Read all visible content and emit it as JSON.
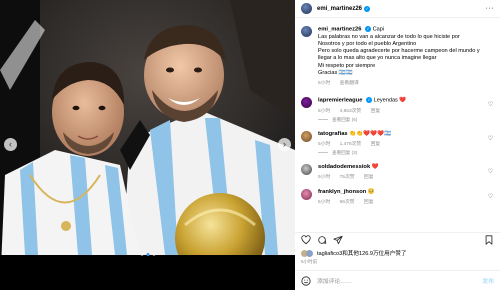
{
  "post": {
    "username": "emi_martinez26",
    "more_label": "···"
  },
  "caption": {
    "username": "emi_martinez26",
    "lines": [
      "Capi",
      "Las palabras no van a alcanzar de todo lo que hiciste por",
      "Nosotros y por todo el pueblo Argentino",
      "Pero solo queda agradecerte por hacerme campeon del mundo y",
      "llegar a lo mas alto que yo nunca imagine llegar",
      "Mi respeto por siempre",
      "Gracias 🇦🇷🇦🇷"
    ],
    "time": "5小时",
    "translate": "查看翻译"
  },
  "comments": [
    {
      "username": "lapremierleague",
      "text": "Leyendas ❤️",
      "time": "5小时",
      "likes": "4,653次赞",
      "reply": "回复",
      "view_replies": "查看回复 (6)"
    },
    {
      "username": "tatografias",
      "text": "👏👏❤️❤️❤️🇦🇷",
      "time": "5小时",
      "likes": "1,476次赞",
      "reply": "回复",
      "view_replies": "查看回复 (3)"
    },
    {
      "username": "soldadodemessiok",
      "text": "❤️",
      "time": "5小时",
      "likes": "75次赞",
      "reply": "回复",
      "view_replies": ""
    },
    {
      "username": "franklyn_jhonson",
      "text": "🥺",
      "time": "5小时",
      "likes": "66次赞",
      "reply": "回复",
      "view_replies": ""
    }
  ],
  "likes_text": "tagliafico3和其他126.9万位用户赞了",
  "post_time": "5小时前",
  "comment_box": {
    "placeholder": "添加评论……",
    "post_label": "发布"
  },
  "colors": {
    "accent": "#0095f6",
    "heart_red": "#ed4956",
    "secondary_text": "#8e8e8e"
  },
  "icons": [
    "more-icon",
    "heart-icon",
    "comment-icon",
    "share-icon",
    "bookmark-icon",
    "smile-icon",
    "chevron-left-icon",
    "chevron-right-icon",
    "verified-icon"
  ]
}
